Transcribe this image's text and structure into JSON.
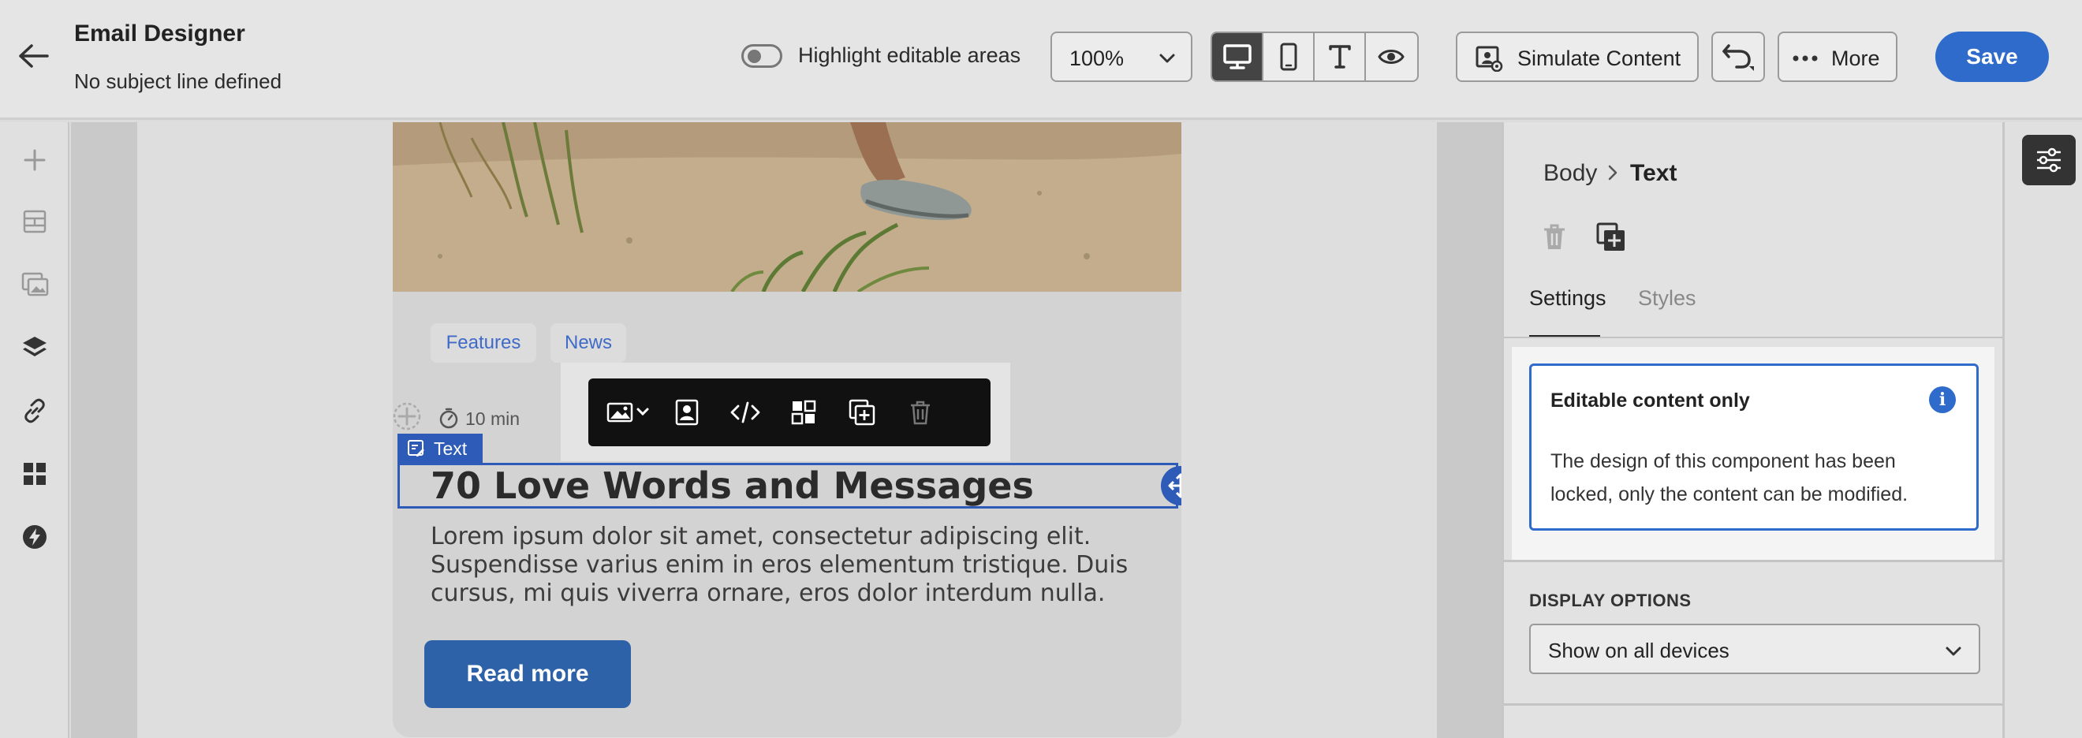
{
  "header": {
    "title": "Email Designer",
    "subject": "No subject line defined",
    "highlight_label": "Highlight editable areas",
    "zoom": "100%",
    "simulate_label": "Simulate Content",
    "more_label": "More",
    "save_label": "Save"
  },
  "canvas": {
    "tags": [
      "Features",
      "News"
    ],
    "read_time": "10 min",
    "component_badge": "Text",
    "headline": "70 Love Words and Messages",
    "body": "Lorem ipsum dolor sit amet, consectetur adipiscing elit. Suspendisse varius enim in eros elementum tristique. Duis cursus, mi quis viverra ornare, eros dolor interdum nulla.",
    "cta": "Read more"
  },
  "right_panel": {
    "breadcrumb": [
      "Body",
      "Text"
    ],
    "tabs": [
      "Settings",
      "Styles"
    ],
    "info": {
      "title": "Editable content only",
      "body": "The design of this component has been locked, only the content can be modified."
    },
    "display_label": "DISPLAY OPTIONS",
    "display_value": "Show on all devices"
  },
  "colors": {
    "accent": "#2e6bcb",
    "selection": "#2e5bb8",
    "cta": "#2d62a8"
  }
}
